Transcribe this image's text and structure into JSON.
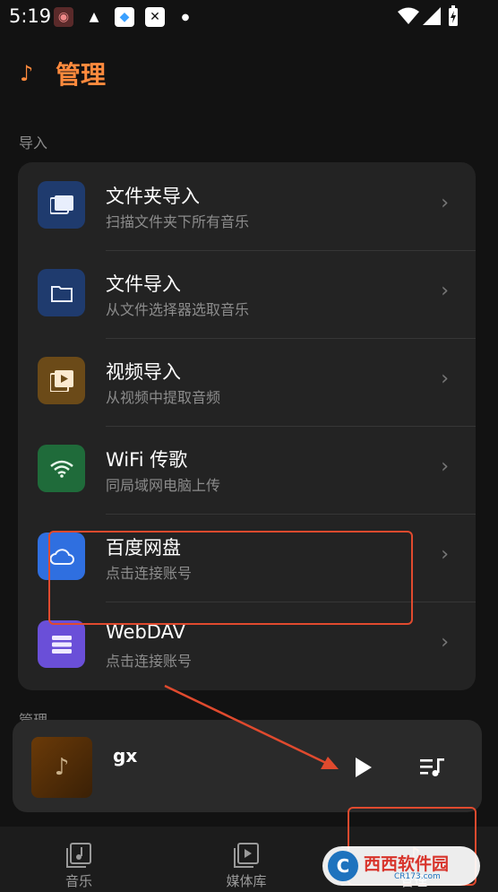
{
  "status_bar": {
    "time": "5:19",
    "icons": [
      "app-icon",
      "warning-icon",
      "app-icon",
      "close-box-icon",
      "dot-icon",
      "wifi-icon",
      "signal-icon",
      "battery-charging-icon"
    ]
  },
  "header": {
    "title": "管理",
    "icon": "music-note-icon",
    "accent": "#ff8a3d"
  },
  "sections": {
    "import_label": "导入",
    "manage_label": "管理"
  },
  "import_items": [
    {
      "title": "文件夹导入",
      "subtitle": "扫描文件夹下所有音乐",
      "icon": "folders-icon",
      "color": "#1f3b6e"
    },
    {
      "title": "文件导入",
      "subtitle": "从文件选择器选取音乐",
      "icon": "folder-icon",
      "color": "#1f3b6e"
    },
    {
      "title": "视频导入",
      "subtitle": "从视频中提取音频",
      "icon": "video-library-icon",
      "color": "#6b4a18"
    },
    {
      "title": "WiFi 传歌",
      "subtitle": "同局域网电脑上传",
      "icon": "wifi-icon",
      "color": "#1f6b3a"
    },
    {
      "title": "百度网盘",
      "subtitle": "点击连接账号",
      "icon": "cloud-icon",
      "color": "#2f6fe0"
    },
    {
      "title": "WebDAV",
      "subtitle": "点击连接账号",
      "icon": "storage-icon",
      "color": "#6a4fd8"
    }
  ],
  "player": {
    "song": "gx",
    "play_icon": "play-icon",
    "queue_icon": "queue-music-icon"
  },
  "bottom_nav": [
    {
      "label": "音乐",
      "icon": "music-library-icon"
    },
    {
      "label": "媒体库",
      "icon": "video-library-icon"
    },
    {
      "label": "管理",
      "icon": "manage-icon"
    }
  ],
  "watermark": {
    "brand": "西西软件园",
    "site": "CR173.com"
  }
}
